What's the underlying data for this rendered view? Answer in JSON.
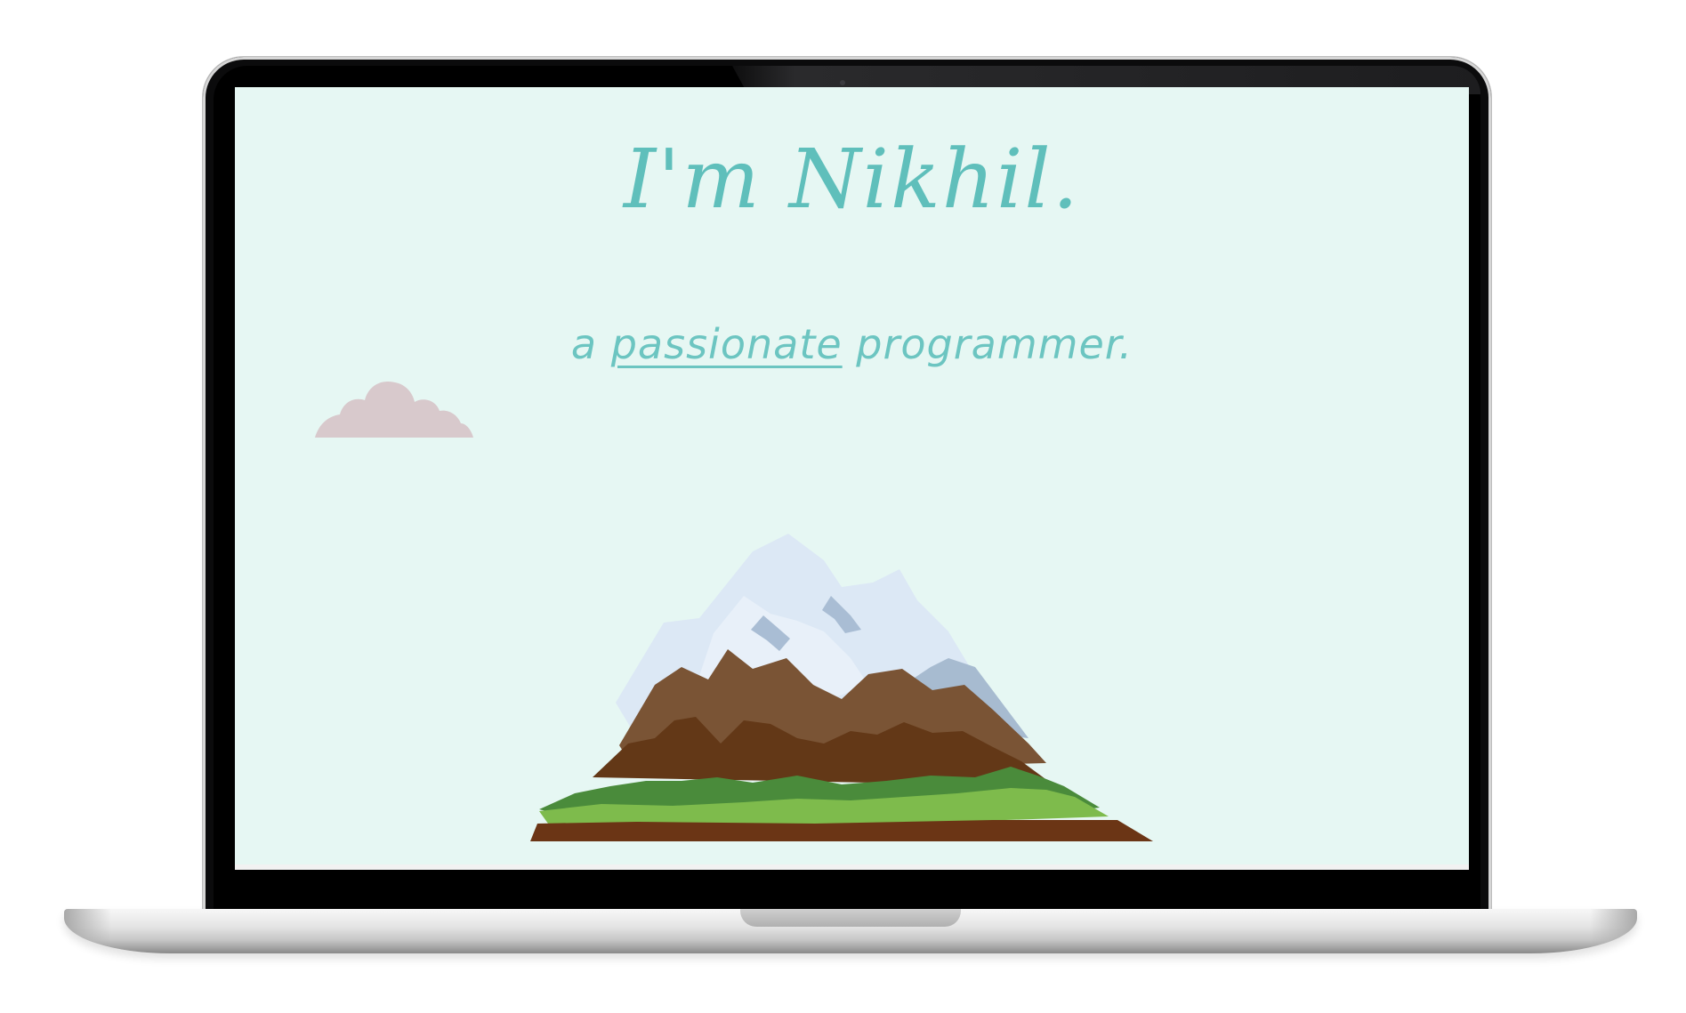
{
  "hero": {
    "title": "I'm Nikhil.",
    "subtitle_prefix": "a",
    "subtitle_highlight": "passionate",
    "subtitle_suffix": "programmer."
  },
  "colors": {
    "screen_background": "#e6f7f3",
    "accent_teal": "#5fbfbb",
    "cloud_pink": "#d8c9cc",
    "snow": "#dfe9f6",
    "rock_brown": "#7a5435",
    "dark_brown": "#5e3315",
    "grass_green": "#4c8a3c",
    "light_grass": "#7fbb4d"
  },
  "icons": {
    "cloud": "cloud-icon",
    "mountain": "mountain-icon"
  }
}
